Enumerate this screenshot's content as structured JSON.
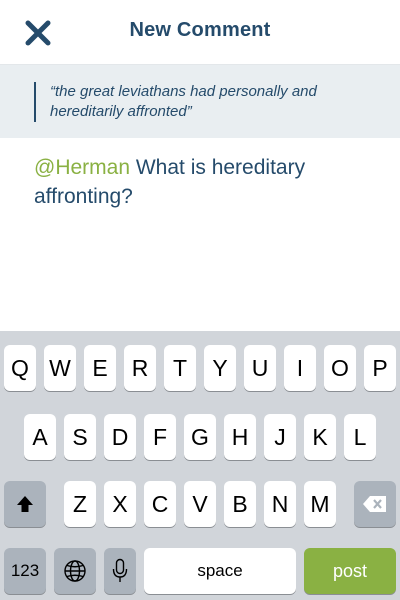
{
  "header": {
    "title": "New Comment",
    "close_icon": "close-icon"
  },
  "quote": {
    "text": "“the great leviathans had personally and hereditarily affronted”"
  },
  "comment": {
    "mention": "@Herman",
    "text": " What is hereditary affronting?"
  },
  "keyboard": {
    "row1": [
      "Q",
      "W",
      "E",
      "R",
      "T",
      "Y",
      "U",
      "I",
      "O",
      "P"
    ],
    "row2": [
      "A",
      "S",
      "D",
      "F",
      "G",
      "H",
      "J",
      "K",
      "L"
    ],
    "row3": [
      "Z",
      "X",
      "C",
      "V",
      "B",
      "N",
      "M"
    ],
    "shift_icon": "shift-up-arrow-icon",
    "delete_icon": "backspace-icon",
    "numbers_label": "123",
    "globe_icon": "globe-icon",
    "mic_icon": "microphone-icon",
    "space_label": "space",
    "post_label": "post"
  },
  "colors": {
    "brand_navy": "#254b6b",
    "accent_green": "#8ab143",
    "quote_bg": "#e9eef1",
    "keyboard_bg": "#d1d5da"
  }
}
